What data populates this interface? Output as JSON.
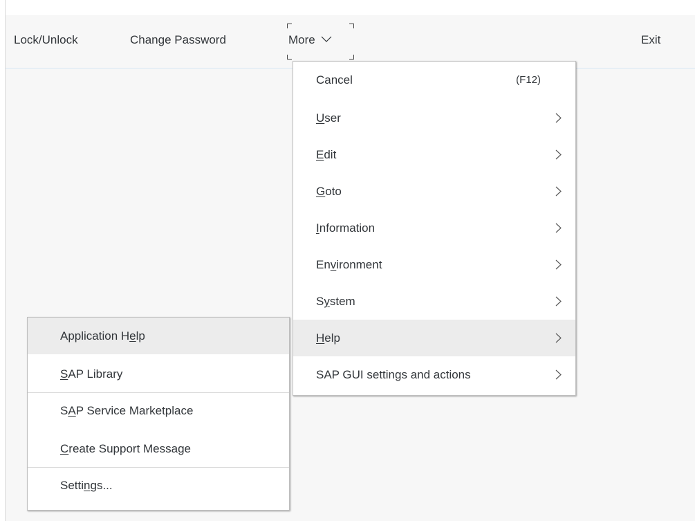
{
  "toolbar": {
    "lock_unlock": "Lock/Unlock",
    "change_password": "Change Password",
    "more": "More",
    "exit": "Exit"
  },
  "main_menu": {
    "items": [
      {
        "pre": "Cancel",
        "u": "",
        "post": "",
        "accel": "(F12)",
        "has_submenu": false
      },
      {
        "pre": "",
        "u": "U",
        "post": "ser",
        "accel": "",
        "has_submenu": true
      },
      {
        "pre": "",
        "u": "E",
        "post": "dit",
        "accel": "",
        "has_submenu": true
      },
      {
        "pre": "",
        "u": "G",
        "post": "oto",
        "accel": "",
        "has_submenu": true
      },
      {
        "pre": "",
        "u": "I",
        "post": "nformation",
        "accel": "",
        "has_submenu": true
      },
      {
        "pre": "En",
        "u": "v",
        "post": "ironment",
        "accel": "",
        "has_submenu": true
      },
      {
        "pre": "S",
        "u": "y",
        "post": "stem",
        "accel": "",
        "has_submenu": true
      },
      {
        "pre": "",
        "u": "H",
        "post": "elp",
        "accel": "",
        "has_submenu": true,
        "highlighted": true
      },
      {
        "pre": "SAP GUI settings and actions",
        "u": "",
        "post": "",
        "accel": "",
        "has_submenu": true
      }
    ]
  },
  "help_menu": {
    "items": [
      {
        "pre": "Application H",
        "u": "e",
        "post": "lp",
        "highlighted": true
      },
      {
        "pre": "",
        "u": "S",
        "post": "AP Library"
      },
      {
        "pre": "S",
        "u": "A",
        "post": "P Service Marketplace"
      },
      {
        "pre": "",
        "u": "C",
        "post": "reate Support Message"
      },
      {
        "pre": "Setti",
        "u": "n",
        "post": "gs..."
      }
    ]
  },
  "colors": {
    "background": "#f7f7f7",
    "menu_background": "#ffffff",
    "highlight": "#ececec",
    "text": "#32363a",
    "toolbar_border": "#d6e6f3"
  },
  "icons": {
    "more_dropdown": "chevron-down-icon",
    "submenu": "chevron-right-icon"
  }
}
